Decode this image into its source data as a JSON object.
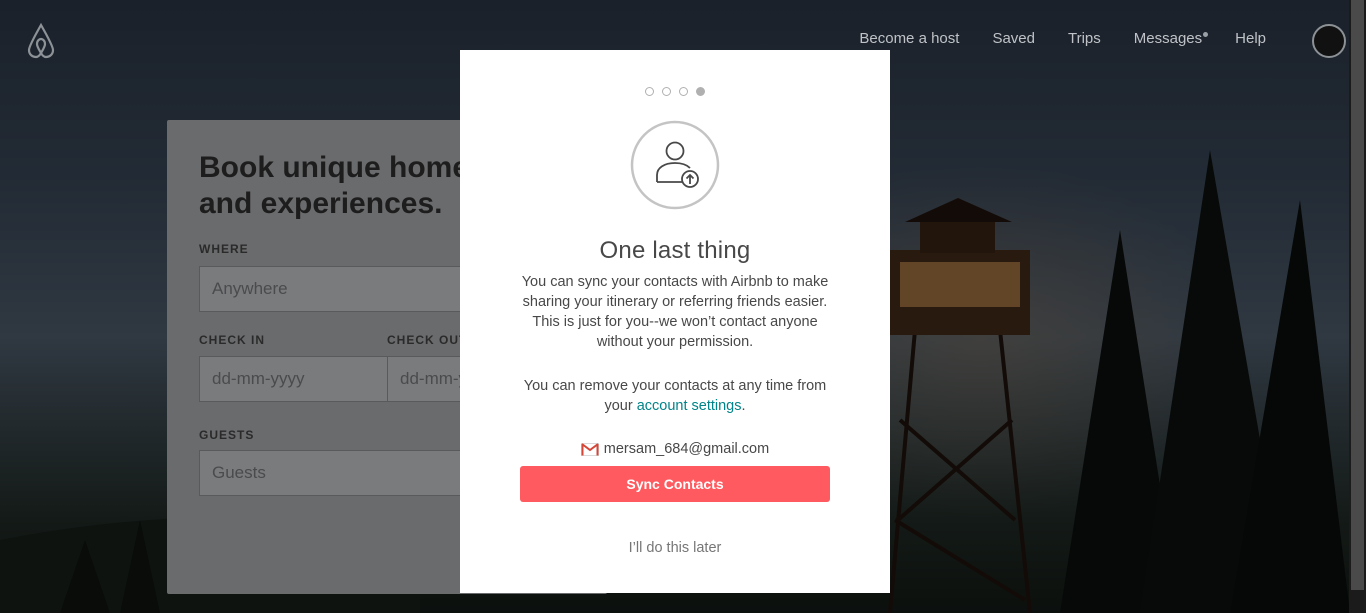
{
  "header": {
    "nav": [
      "Become a host",
      "Saved",
      "Trips",
      "Messages",
      "Help"
    ],
    "logo_icon": "airbnb-logo-icon",
    "avatar_icon": "avatar-icon"
  },
  "search_card": {
    "title": "Book unique homes and experiences.",
    "where_label": "WHERE",
    "where_placeholder": "Anywhere",
    "checkin_label": "CHECK IN",
    "checkin_placeholder": "dd-mm-yyyy",
    "checkout_label": "CHECK OUT",
    "checkout_placeholder": "dd-mm-yyyy",
    "guests_label": "GUESTS",
    "guests_placeholder": "Guests"
  },
  "modal": {
    "step_total": 4,
    "step_current": 4,
    "icon": "contact-upload-icon",
    "title": "One last thing",
    "paragraph1": "You can sync your contacts with Airbnb to make sharing your itinerary or referring friends easier. This is just for you--we won’t contact anyone without your permission.",
    "paragraph2_before": "You can remove your contacts at any time from your ",
    "paragraph2_link": "account settings",
    "paragraph2_after": ".",
    "email_icon": "gmail-icon",
    "email": "mersam_684@gmail.com",
    "sync_button": "Sync Contacts",
    "later_link": "I’ll do this later"
  },
  "colors": {
    "accent": "#ff5a5f",
    "link": "#008489",
    "text": "#484848"
  }
}
